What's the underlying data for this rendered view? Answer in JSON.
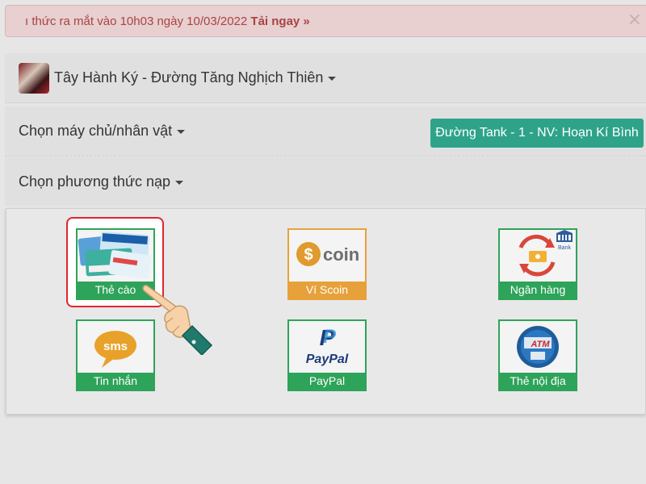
{
  "banner": {
    "text": "ı thức ra mắt vào 10h03 ngày 10/03/2022",
    "link": "Tải ngay »",
    "close": "×"
  },
  "game": {
    "title": "Tây Hành Ký - Đường Tăng Nghịch Thiên"
  },
  "server": {
    "label": "Chọn máy chủ/nhân vật",
    "selected": "Đường Tank - 1 - NV: Hoạn Kí Bình"
  },
  "method": {
    "label": "Chọn phương thức nạp"
  },
  "options": [
    {
      "label": "Thẻ cào",
      "icon": "scratch-card-icon",
      "color": "#2ea35a"
    },
    {
      "label": "Ví Scoin",
      "icon": "scoin-wallet-icon",
      "color": "#e7a13a",
      "logo_text": "coin"
    },
    {
      "label": "Ngân hàng",
      "icon": "bank-icon",
      "color": "#2ea35a",
      "badge_text": "Bank"
    },
    {
      "label": "Tin nhắn",
      "icon": "sms-icon",
      "color": "#2ea35a",
      "logo_text": "sms"
    },
    {
      "label": "PayPal",
      "icon": "paypal-icon",
      "color": "#2ea35a",
      "logo_text": "PayPal"
    },
    {
      "label": "Thẻ nội địa",
      "icon": "atm-card-icon",
      "color": "#2ea35a",
      "logo_text": "ATM"
    }
  ],
  "colors": {
    "accent": "#2ea38a",
    "tile_green": "#2ea35a",
    "tile_orange": "#e7a13a",
    "banner_text": "#a94442",
    "highlight": "#e0262d"
  }
}
